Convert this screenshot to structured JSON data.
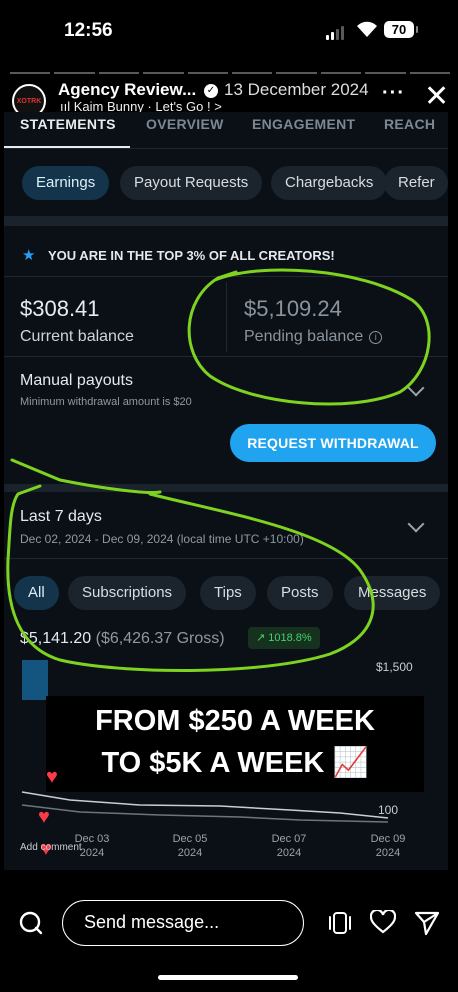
{
  "status": {
    "time": "12:56",
    "battery": "70"
  },
  "story": {
    "account_name": "Agency Review...",
    "date": "13 December 2024",
    "music": "ııl Kaim Bunny · Let's Go ! >",
    "avatar_text": "XOTRK"
  },
  "app": {
    "tabs": [
      "STATEMENTS",
      "OVERVIEW",
      "ENGAGEMENT",
      "REACH"
    ],
    "sub_tabs": [
      "Earnings",
      "Payout Requests",
      "Chargebacks",
      "Refer"
    ],
    "banner": "YOU ARE IN THE TOP 3% OF ALL CREATORS!",
    "current_balance": {
      "amount": "$308.41",
      "label": "Current balance"
    },
    "pending_balance": {
      "amount": "$5,109.24",
      "label": "Pending balance",
      "info_icon": "i"
    },
    "manual_payouts": {
      "title": "Manual payouts",
      "subtitle": "Minimum withdrawal amount is $20"
    },
    "request_button": "REQUEST WITHDRAWAL",
    "period": {
      "title": "Last 7 days",
      "range": "Dec 02, 2024 - Dec 09, 2024 (local time UTC +10:00)"
    },
    "filters": [
      "All",
      "Subscriptions",
      "Tips",
      "Posts",
      "Messages"
    ],
    "net": "$5,141.20",
    "gross": "($6,426.37 Gross)",
    "growth": "↗ 1018.8%"
  },
  "chart_data": {
    "type": "line",
    "y_axis_labels": [
      "$1,500",
      "100"
    ],
    "x_labels": [
      [
        "Dec 03",
        "2024"
      ],
      [
        "Dec 05",
        "2024"
      ],
      [
        "Dec 07",
        "2024"
      ],
      [
        "Dec 09",
        "2024"
      ]
    ]
  },
  "overlay": {
    "line1": "FROM $250 A WEEK",
    "line2": "TO $5K A WEEK",
    "emoji": "📈"
  },
  "comment_hint": "Add comment",
  "reply": {
    "placeholder": "Send message..."
  }
}
